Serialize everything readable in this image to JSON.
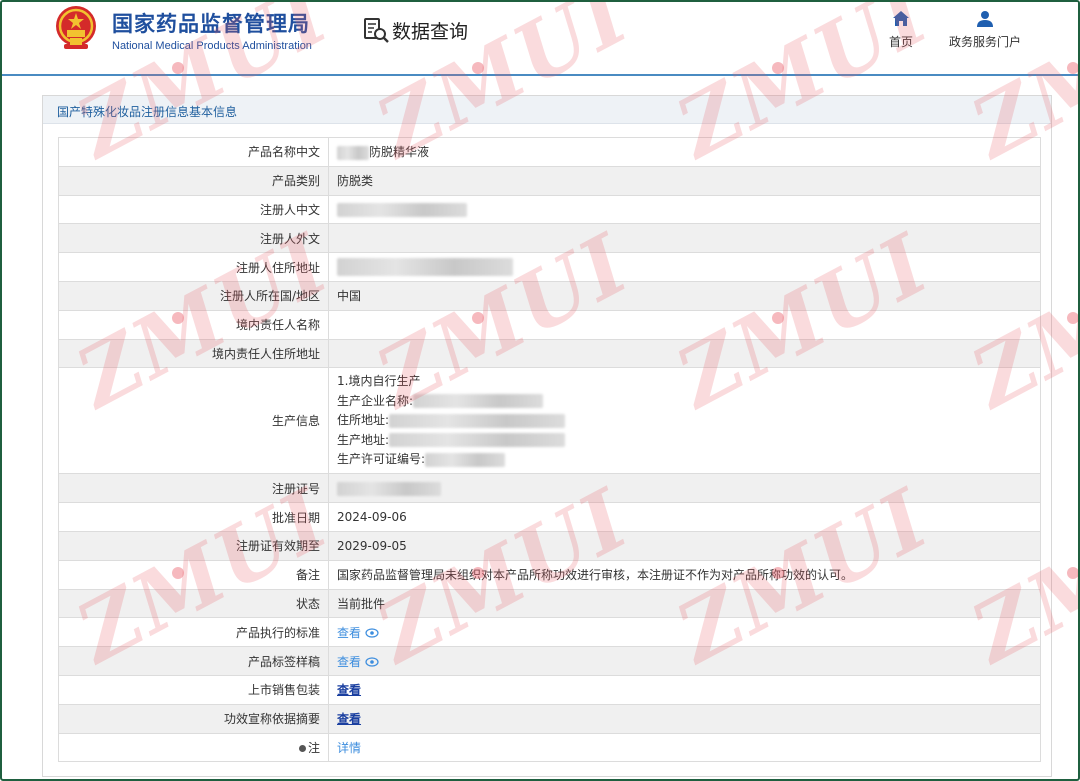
{
  "header": {
    "org_cn": "国家药品监督管理局",
    "org_en": "National Medical Products Administration",
    "query_label": "数据查询",
    "nav": [
      {
        "label": "首页",
        "icon": "home-icon"
      },
      {
        "label": "政务服务门户",
        "icon": "user-icon"
      }
    ]
  },
  "panel": {
    "title": "国产特殊化妆品注册信息基本信息"
  },
  "fields": {
    "product_name_cn": {
      "label": "产品名称中文",
      "value": "防脱精华液"
    },
    "product_category": {
      "label": "产品类别",
      "value": "防脱类"
    },
    "registrant_cn": {
      "label": "注册人中文",
      "value": ""
    },
    "registrant_foreign": {
      "label": "注册人外文",
      "value": ""
    },
    "registrant_address": {
      "label": "注册人住所地址",
      "value": ""
    },
    "registrant_country": {
      "label": "注册人所在国/地区",
      "value": "中国"
    },
    "domestic_agent_name": {
      "label": "境内责任人名称",
      "value": ""
    },
    "domestic_agent_address": {
      "label": "境内责任人住所地址",
      "value": ""
    },
    "production_info": {
      "label": "生产信息",
      "line1": "1.境内自行生产",
      "company_label": "生产企业名称:",
      "residence_label": "住所地址:",
      "production_address_label": "生产地址:",
      "license_label": "生产许可证编号:"
    },
    "registration_no": {
      "label": "注册证号",
      "value": ""
    },
    "approval_date": {
      "label": "批准日期",
      "value": "2024-09-06"
    },
    "valid_until": {
      "label": "注册证有效期至",
      "value": "2029-09-05"
    },
    "remark": {
      "label": "备注",
      "value": "国家药品监督管理局未组织对本产品所称功效进行审核，本注册证不作为对产品所称功效的认可。"
    },
    "status": {
      "label": "状态",
      "value": "当前批件"
    },
    "standard": {
      "label": "产品执行的标准",
      "link": "查看"
    },
    "label_sample": {
      "label": "产品标签样稿",
      "link": "查看"
    },
    "sales_package": {
      "label": "上市销售包装",
      "link": "查看"
    },
    "efficacy_summary": {
      "label": "功效宣称依据摘要",
      "link": "查看"
    },
    "note": {
      "label": "注",
      "link": "详情"
    }
  },
  "watermark": {
    "text": "ZMUI"
  },
  "colors": {
    "brand_blue": "#1f4f9e",
    "link_blue": "#3c8dde",
    "frame_green": "#1f5f3f",
    "watermark_red": "#e65a64"
  }
}
